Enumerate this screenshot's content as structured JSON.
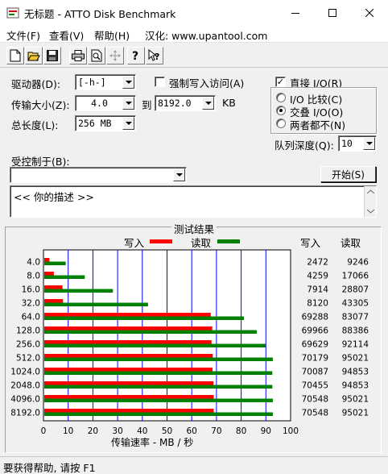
{
  "window": {
    "title": "无标题 - ATTO Disk Benchmark",
    "controls": {
      "minimize_icon": "minimize-icon",
      "maximize_icon": "maximize-icon",
      "close_icon": "close-icon"
    }
  },
  "menu": {
    "file": "文件(F)",
    "view": "查看(V)",
    "help": "帮助(H)",
    "credit": "汉化: www.upantool.com"
  },
  "toolbar": {
    "icons": [
      "new-file-icon",
      "open-folder-icon",
      "save-icon",
      "print-icon",
      "print-preview-icon",
      "move-icon",
      "help-icon",
      "context-help-icon"
    ]
  },
  "settings": {
    "drive_label": "驱动器(D):",
    "drive_value": "[-h-]",
    "force_write_label": "强制写入访问(A)",
    "force_write_checked": false,
    "transfer_label": "传输大小(Z):",
    "transfer_from": "4.0",
    "transfer_to_label": "到",
    "transfer_to": "8192.0",
    "transfer_unit": "KB",
    "length_label": "总长度(L):",
    "length_value": "256 MB",
    "direct_io_label": "直接 I/O(R)",
    "direct_io_checked": true,
    "io_compare_label": "I/O 比较(C)",
    "overlap_io_label": "交叠 I/O(O)",
    "neither_label": "两者都不(N)",
    "selected_mode": "overlap",
    "queue_depth_label": "队列深度(Q):",
    "queue_depth_value": "10",
    "controlled_by_label": "受控制于(B):",
    "controlled_by_value": "",
    "start_button": "开始(S)",
    "description_text": "<<   你的描述   >>"
  },
  "results": {
    "title": "测试结果",
    "write_legend": "写入",
    "read_legend": "读取",
    "write_header": "写入",
    "read_header": "读取",
    "write_color": "#ff0000",
    "read_color": "#008000",
    "grid_color": "#0000ff",
    "x_axis_label": "传输速率 - MB / 秒",
    "x_ticks": [
      "0",
      "10",
      "20",
      "30",
      "40",
      "50",
      "60",
      "70",
      "80",
      "90",
      "100"
    ]
  },
  "chart_data": {
    "type": "bar",
    "orientation": "horizontal",
    "title": "测试结果",
    "xlabel": "传输速率 - MB / 秒",
    "ylabel": "",
    "xlim": [
      0,
      100
    ],
    "grid": true,
    "legend": "top",
    "categories": [
      "4.0",
      "8.0",
      "16.0",
      "32.0",
      "64.0",
      "128.0",
      "256.0",
      "512.0",
      "1024.0",
      "2048.0",
      "4096.0",
      "8192.0"
    ],
    "series": [
      {
        "name": "写入",
        "values": [
          2.4,
          4.2,
          7.7,
          7.9,
          67.7,
          68.3,
          68.0,
          68.5,
          68.4,
          68.8,
          68.9,
          68.9
        ]
      },
      {
        "name": "读取",
        "values": [
          9.0,
          16.7,
          28.1,
          42.3,
          81.1,
          86.3,
          89.9,
          92.8,
          92.6,
          92.6,
          92.8,
          92.8
        ]
      }
    ],
    "write_values_text": [
      "2472",
      "4259",
      "7914",
      "8120",
      "69288",
      "69966",
      "69629",
      "70179",
      "70087",
      "70455",
      "70548",
      "70548"
    ],
    "read_values_text": [
      "9246",
      "17066",
      "28807",
      "43305",
      "83077",
      "88386",
      "92114",
      "95021",
      "94853",
      "94853",
      "95021",
      "95021"
    ]
  },
  "statusbar": {
    "text": "要获得帮助, 请按 F1"
  }
}
